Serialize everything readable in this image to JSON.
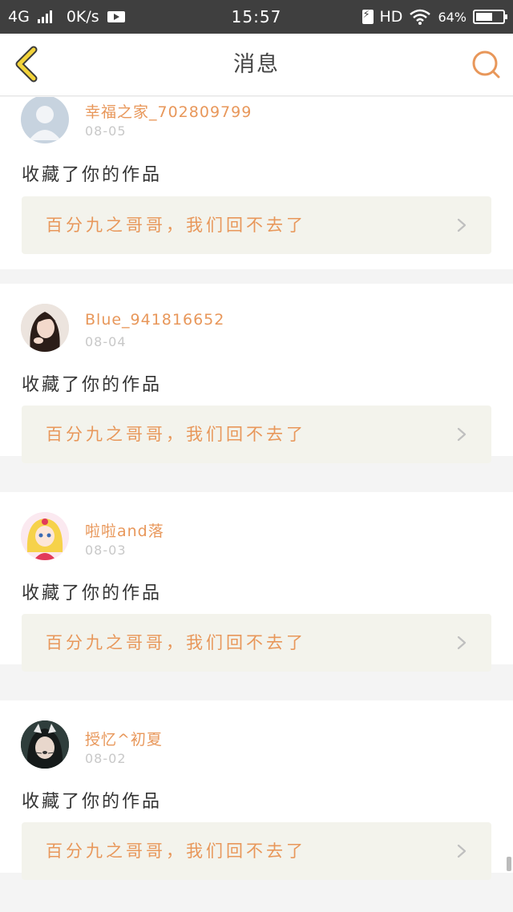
{
  "status_bar": {
    "network": "4G",
    "speed": "0K/s",
    "time": "15:57",
    "hd": "HD",
    "battery": "64%",
    "battery_level": 0.64
  },
  "header": {
    "title": "消息"
  },
  "colors": {
    "accent": "#e8975a",
    "work_box_bg": "#f3f3ec",
    "status_bar_bg": "#3f3f3f"
  },
  "messages": [
    {
      "username": "幸福之家_702809799",
      "date": "08-05",
      "action": "收藏了你的作品",
      "work_title": "百分九之哥哥，我们回不去了",
      "avatar": "default-avatar"
    },
    {
      "username": "Blue_941816652",
      "date": "08-04",
      "action": "收藏了你的作品",
      "work_title": "百分九之哥哥，我们回不去了",
      "avatar": "girl-photo-avatar"
    },
    {
      "username": "啦啦and落",
      "date": "08-03",
      "action": "收藏了你的作品",
      "work_title": "百分九之哥哥，我们回不去了",
      "avatar": "anime-girl-avatar"
    },
    {
      "username": "授忆^初夏",
      "date": "08-02",
      "action": "收藏了你的作品",
      "work_title": "百分九之哥哥，我们回不去了",
      "avatar": "cat-filter-avatar"
    }
  ]
}
